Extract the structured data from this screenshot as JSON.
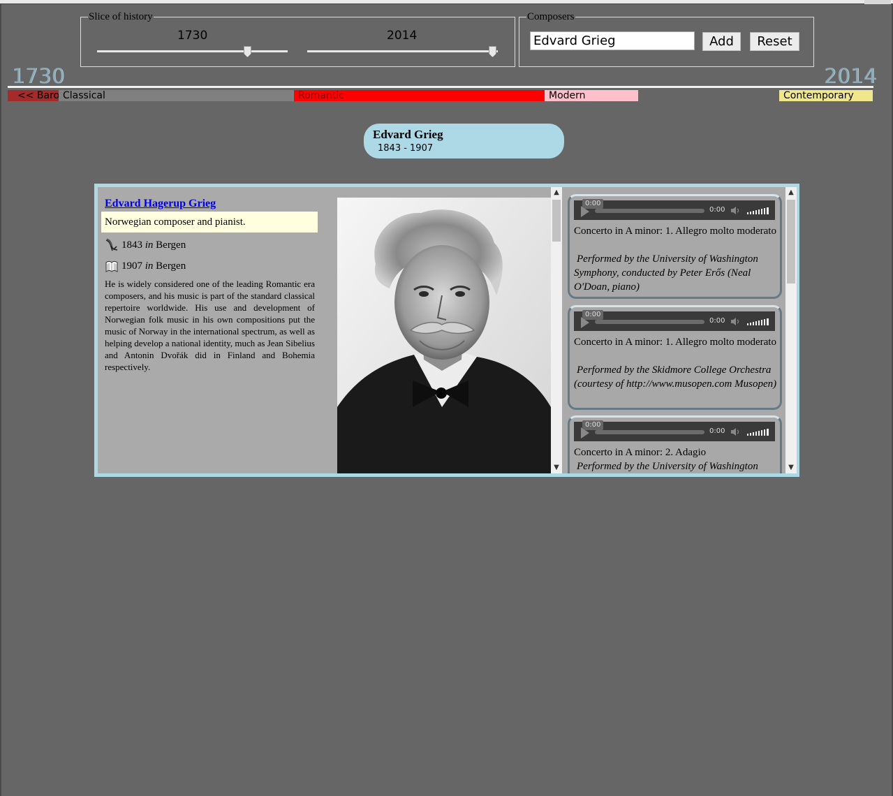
{
  "slice": {
    "legend": "Slice of history",
    "start_year": "1730",
    "end_year": "2014"
  },
  "composers": {
    "legend": "Composers",
    "input_value": "Edvard Grieg",
    "add_label": "Add",
    "reset_label": "Reset"
  },
  "timeline": {
    "start_label": "1730",
    "end_label": "2014",
    "eras": [
      {
        "label": "<< Baroque",
        "color": "#a52a2a"
      },
      {
        "label": "Classical",
        "color": "#808080"
      },
      {
        "label": "Romantic",
        "color": "#ff0000"
      },
      {
        "label": "Modern",
        "color": "#ffc0cb"
      },
      {
        "label": "Contemporary",
        "color": "#f0e68c"
      }
    ]
  },
  "selected": {
    "name": "Edvard Grieg",
    "dates": "1843 - 1907"
  },
  "detail": {
    "full_name": "Edvard Hagerup Grieg",
    "description": "Norwegian composer and pianist.",
    "birth_year": "1843",
    "birth_place": "Bergen",
    "death_year": "1907",
    "death_place": "Bergen",
    "in_word": "in",
    "bio": "He is widely considered one of the leading Romantic era composers, and his music is part of the standard classical repertoire worldwide. His use and development of Norwegian folk music in his own compositions put the music of Norway in the international spectrum, as well as helping develop a national identity, much as Jean Sibelius and Antonin Dvořák did in Finland and Bohemia respectively."
  },
  "recordings": [
    {
      "popup_time": "0:00",
      "current_time": "0:00",
      "title": "Concerto in A minor: 1. Allegro molto moderato",
      "performer": "Performed by the University of Washington Symphony, conducted by Peter Erős (Neal O'Doan, piano)"
    },
    {
      "popup_time": "0:00",
      "current_time": "0:00",
      "title": "Concerto in A minor: 1. Allegro molto moderato",
      "performer": "Performed by the Skidmore College Orchestra (courtesy of http://www.musopen.com Musopen)"
    },
    {
      "popup_time": "0:00",
      "current_time": "0:00",
      "title": "Concerto in A minor: 2. Adagio",
      "performer": "Performed by the University of Washington"
    }
  ],
  "icons": {
    "birth": "quill-icon",
    "death": "book-icon",
    "play": "play-icon",
    "mute": "speaker-icon",
    "volume": "volume-bars-icon"
  }
}
